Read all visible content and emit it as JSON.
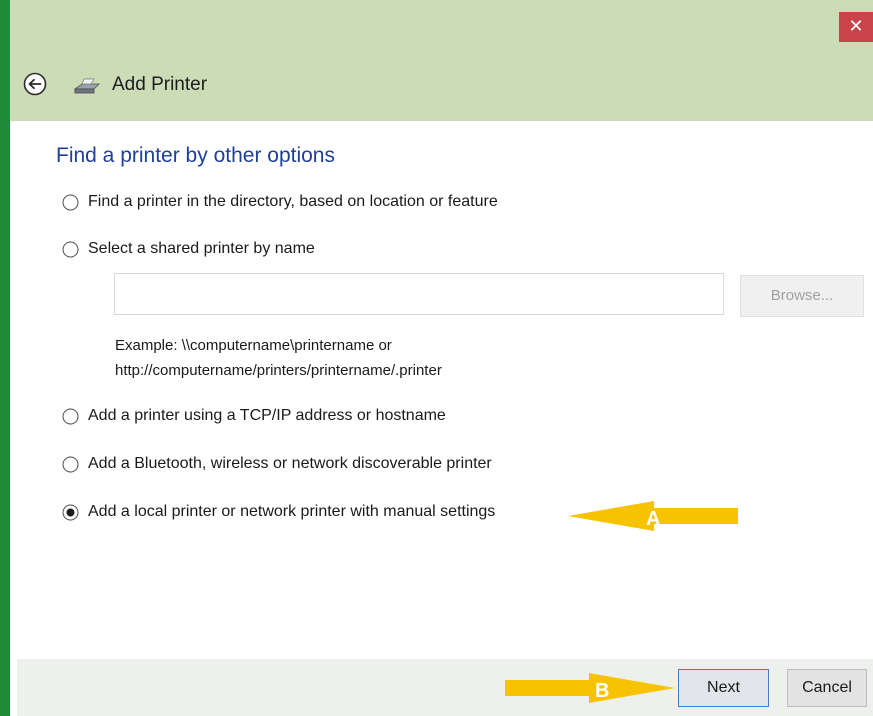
{
  "window": {
    "title": "Add Printer",
    "close_symbol": "✕"
  },
  "icons": {
    "back": "back-arrow-icon",
    "printer": "printer-icon",
    "close": "close-icon",
    "radio": "radio-button-icon"
  },
  "colors": {
    "heading": "#1f3f9a",
    "titlebar": "#cbdcb6",
    "close": "#c8444a",
    "annotation_arrow": "#f7c300",
    "left_border": "#1f8a3a"
  },
  "content": {
    "heading": "Find a printer by other options",
    "options": [
      {
        "label": "Find a printer in the directory, based on location or feature",
        "selected": false
      },
      {
        "label": "Select a shared printer by name",
        "selected": false
      },
      {
        "label": "Add a printer using a TCP/IP address or hostname",
        "selected": false
      },
      {
        "label": "Add a Bluetooth, wireless or network discoverable printer",
        "selected": false
      },
      {
        "label": "Add a local printer or network printer with manual settings",
        "selected": true
      }
    ],
    "shared_printer": {
      "value": "",
      "browse_label": "Browse..."
    },
    "example_line1": "Example: \\\\computername\\printername or",
    "example_line2": "http://computername/printers/printername/.printer"
  },
  "footer": {
    "next_label": "Next",
    "cancel_label": "Cancel"
  },
  "annotations": {
    "arrow_a_label": "A",
    "arrow_b_label": "B"
  }
}
